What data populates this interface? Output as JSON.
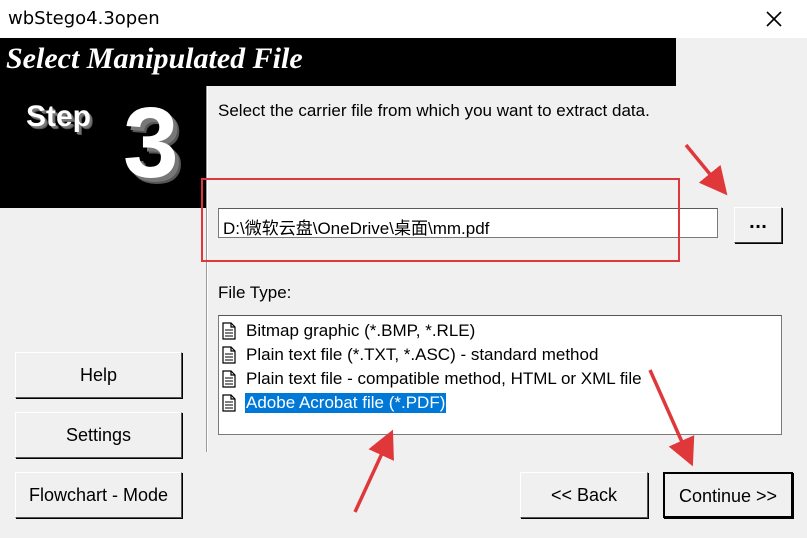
{
  "window": {
    "title": "wbStego4.3open"
  },
  "banner": {
    "title": "Select Manipulated File"
  },
  "step": {
    "word": "Step",
    "number": "3"
  },
  "instruction": "Select the carrier file from which you want to extract data.",
  "path_field": {
    "value": "D:\\微软云盘\\OneDrive\\桌面\\mm.pdf"
  },
  "browse_button": {
    "label": "..."
  },
  "file_type": {
    "label": "File Type:",
    "options": [
      "Bitmap graphic (*.BMP, *.RLE)",
      "Plain text file (*.TXT, *.ASC) - standard method",
      "Plain text file - compatible method, HTML or XML file",
      "Adobe Acrobat file (*.PDF)"
    ],
    "selected": "Adobe Acrobat file (*.PDF)"
  },
  "buttons": {
    "help": "Help",
    "settings": "Settings",
    "flowchart": "Flowchart - Mode",
    "back": "<< Back",
    "continue": "Continue >>"
  },
  "colors": {
    "annotation": "#e0383a",
    "selection": "#0078d7",
    "dialog_bg": "#f0f0f0",
    "banner_bg": "#000000"
  },
  "icons": [
    "close-icon",
    "document-icon"
  ]
}
